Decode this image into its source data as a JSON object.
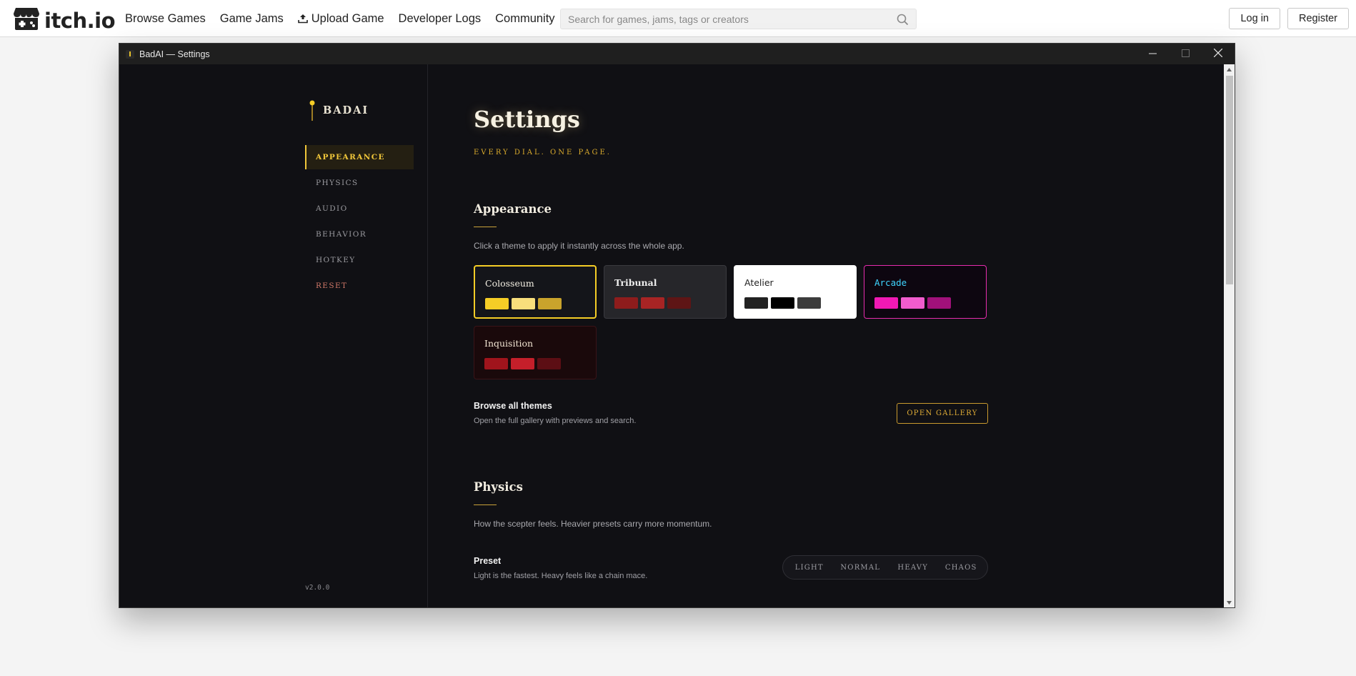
{
  "site": {
    "logo_text": "itch.io",
    "nav": [
      "Browse Games",
      "Game Jams",
      "Upload Game",
      "Developer Logs",
      "Community"
    ],
    "search_placeholder": "Search for games, jams, tags or creators",
    "login_label": "Log in",
    "register_label": "Register"
  },
  "window": {
    "title": "BadAI — Settings"
  },
  "sidebar": {
    "brand": "BADAI",
    "items": [
      {
        "label": "APPEARANCE",
        "active": true
      },
      {
        "label": "PHYSICS",
        "active": false
      },
      {
        "label": "AUDIO",
        "active": false
      },
      {
        "label": "BEHAVIOR",
        "active": false
      },
      {
        "label": "HOTKEY",
        "active": false
      },
      {
        "label": "RESET",
        "active": false,
        "danger": true
      }
    ],
    "version": "v2.0.0"
  },
  "main": {
    "title": "Settings",
    "subtitle": "EVERY DIAL. ONE PAGE.",
    "appearance": {
      "title": "Appearance",
      "description": "Click a theme to apply it instantly across the whole app.",
      "themes": [
        {
          "name": "Colosseum",
          "selected": true,
          "bg": "#14151a",
          "border": "#f5cd26",
          "text": "#f3efe3",
          "swatches": [
            "#f5cd26",
            "#f8de7c",
            "#c9a32c"
          ]
        },
        {
          "name": "Tribunal",
          "selected": false,
          "bg": "#26262a",
          "border": "#3a3a3f",
          "text": "#eeeeee",
          "swatches": [
            "#8e1c1c",
            "#a82424",
            "#5e1515"
          ]
        },
        {
          "name": "Atelier",
          "selected": false,
          "bg": "#ffffff",
          "border": "#ffffff",
          "text": "#222222",
          "swatches": [
            "#222222",
            "#000000",
            "#3c3c3c"
          ]
        },
        {
          "name": "Arcade",
          "selected": false,
          "bg": "#0d0610",
          "border": "#e62cae",
          "text": "#3fd4ff",
          "swatches": [
            "#f019b4",
            "#f15ccd",
            "#a1117a"
          ]
        },
        {
          "name": "Inquisition",
          "selected": false,
          "bg": "#1a090b",
          "border": "#3a1418",
          "text": "#f1e4d2",
          "swatches": [
            "#a0141c",
            "#c51f2a",
            "#5c0e14"
          ]
        }
      ],
      "browse": {
        "title": "Browse all themes",
        "description": "Open the full gallery with previews and search.",
        "button": "OPEN GALLERY"
      }
    },
    "physics": {
      "title": "Physics",
      "description": "How the scepter feels. Heavier presets carry more momentum.",
      "preset": {
        "title": "Preset",
        "description": "Light is the fastest. Heavy feels like a chain mace.",
        "options": [
          "LIGHT",
          "NORMAL",
          "HEAVY",
          "CHAOS"
        ],
        "selected": "NORMAL"
      }
    }
  }
}
